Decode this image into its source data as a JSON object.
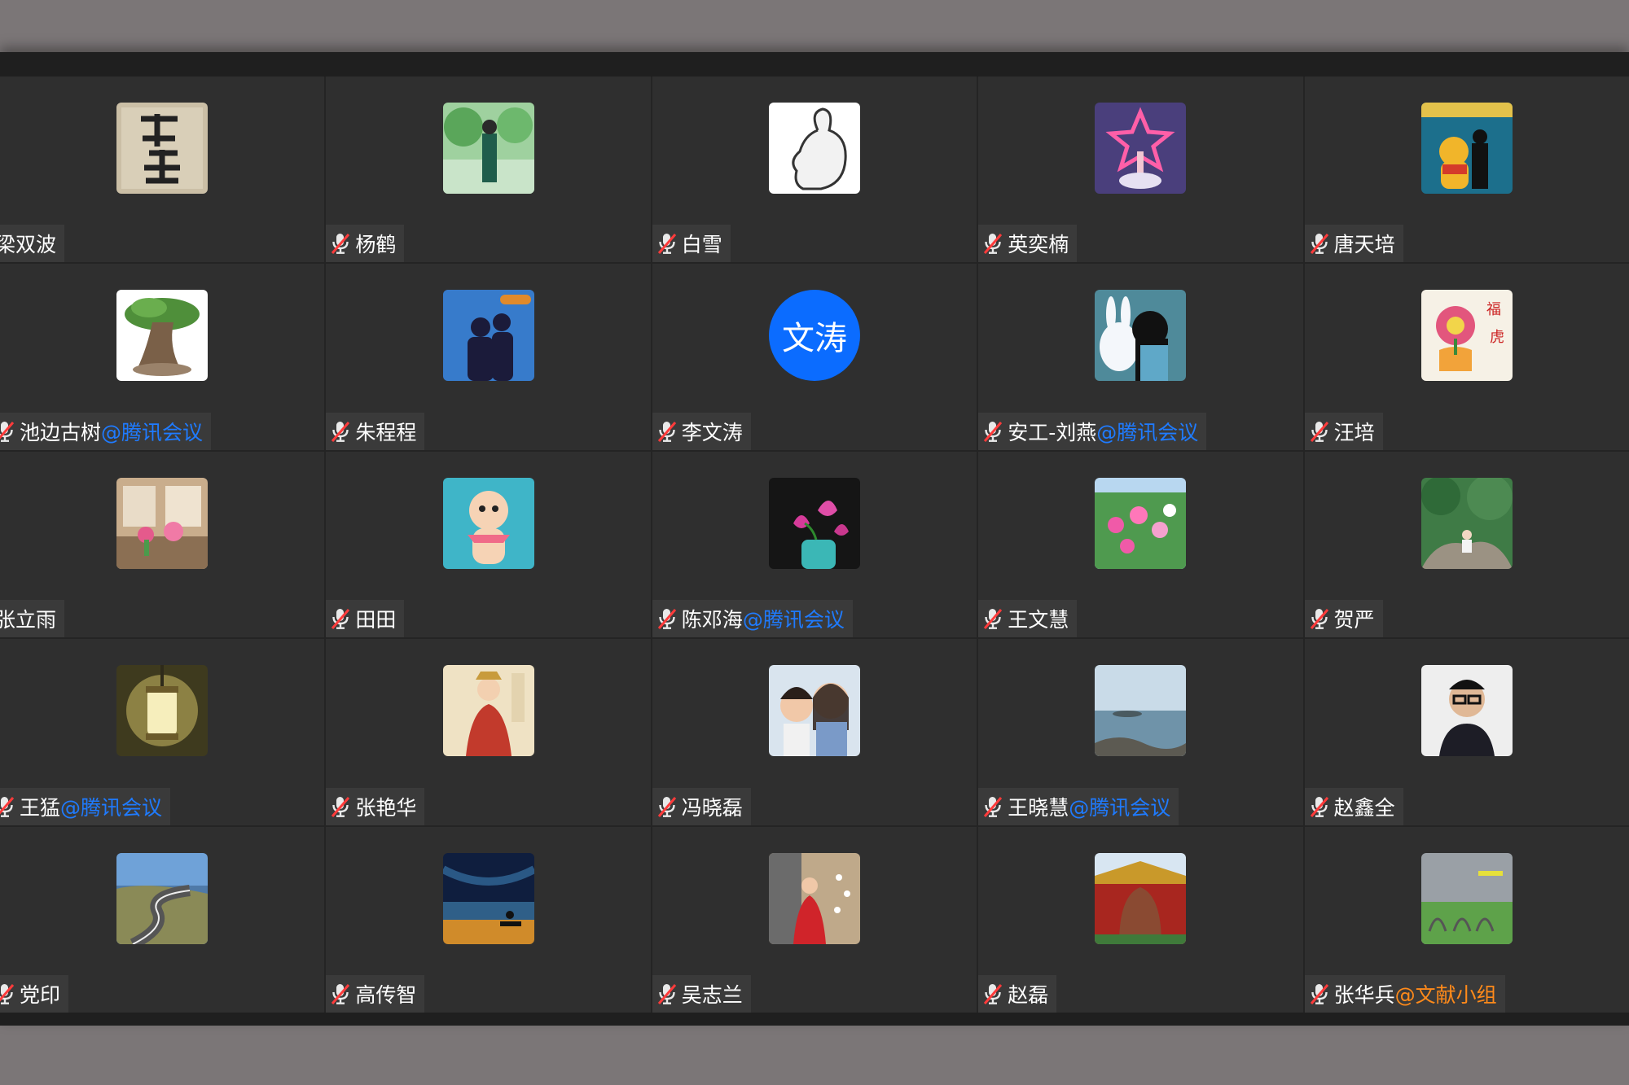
{
  "theme": {
    "blue_suffix": "#1f7bff",
    "orange_suffix": "#ff8a1a",
    "text_initial_avatar_bg": "#0b6cff"
  },
  "participants": [
    {
      "name": "梁双波",
      "suffix": "",
      "suffix_color": "",
      "muted": false,
      "avatar": "calligraphy-image"
    },
    {
      "name": "杨鹤",
      "suffix": "",
      "suffix_color": "",
      "muted": true,
      "avatar": "woman-garden-photo"
    },
    {
      "name": "白雪",
      "suffix": "",
      "suffix_color": "",
      "muted": true,
      "avatar": "cartoon-rabbit-sketch"
    },
    {
      "name": "英奕楠",
      "suffix": "",
      "suffix_color": "",
      "muted": true,
      "avatar": "star-wand-illustration"
    },
    {
      "name": "唐天培",
      "suffix": "",
      "suffix_color": "",
      "muted": true,
      "avatar": "winnie-pooh-image"
    },
    {
      "name": "池边古树",
      "suffix": "@腾讯会议",
      "suffix_color": "blue",
      "muted": true,
      "avatar": "bonsai-tree-photo"
    },
    {
      "name": "朱程程",
      "suffix": "",
      "suffix_color": "",
      "muted": true,
      "avatar": "couple-aquarium-photo"
    },
    {
      "name": "李文涛",
      "suffix": "",
      "suffix_color": "",
      "muted": true,
      "avatar": "text-initials",
      "avatar_text": "文涛"
    },
    {
      "name": "安工-刘燕",
      "suffix": "@腾讯会议",
      "suffix_color": "blue",
      "muted": true,
      "avatar": "anime-girl-illustration"
    },
    {
      "name": "汪培",
      "suffix": "",
      "suffix_color": "",
      "muted": true,
      "avatar": "flower-lion-drawing"
    },
    {
      "name": "张立雨",
      "suffix": "",
      "suffix_color": "",
      "muted": false,
      "avatar": "flowers-room-photo"
    },
    {
      "name": "田田",
      "suffix": "",
      "suffix_color": "",
      "muted": true,
      "avatar": "kewpie-doll-photo"
    },
    {
      "name": "陈邓海",
      "suffix": "@腾讯会议",
      "suffix_color": "blue",
      "muted": true,
      "avatar": "lotus-vase-photo"
    },
    {
      "name": "王文慧",
      "suffix": "",
      "suffix_color": "",
      "muted": true,
      "avatar": "cosmos-flowers-photo"
    },
    {
      "name": "贺严",
      "suffix": "",
      "suffix_color": "",
      "muted": true,
      "avatar": "rock-trees-photo"
    },
    {
      "name": "王猛",
      "suffix": "@腾讯会议",
      "suffix_color": "blue",
      "muted": true,
      "avatar": "lantern-photo"
    },
    {
      "name": "张艳华",
      "suffix": "",
      "suffix_color": "",
      "muted": true,
      "avatar": "historical-figure-painting"
    },
    {
      "name": "冯晓磊",
      "suffix": "",
      "suffix_color": "",
      "muted": true,
      "avatar": "mother-daughter-photo"
    },
    {
      "name": "王晓慧",
      "suffix": "@腾讯会议",
      "suffix_color": "blue",
      "muted": true,
      "avatar": "seascape-photo"
    },
    {
      "name": "赵鑫全",
      "suffix": "",
      "suffix_color": "",
      "muted": true,
      "avatar": "man-glasses-portrait"
    },
    {
      "name": "党印",
      "suffix": "",
      "suffix_color": "",
      "muted": true,
      "avatar": "coastal-road-photo"
    },
    {
      "name": "高传智",
      "suffix": "",
      "suffix_color": "",
      "muted": true,
      "avatar": "sunset-bench-photo"
    },
    {
      "name": "吴志兰",
      "suffix": "",
      "suffix_color": "",
      "muted": true,
      "avatar": "red-coat-photo"
    },
    {
      "name": "赵磊",
      "suffix": "",
      "suffix_color": "",
      "muted": true,
      "avatar": "palace-lion-photo"
    },
    {
      "name": "张华兵",
      "suffix": "@文献小组",
      "suffix_color": "orange",
      "muted": true,
      "avatar": "green-lawn-photo"
    }
  ]
}
